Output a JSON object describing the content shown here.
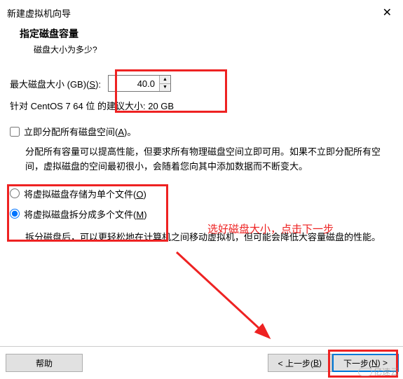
{
  "window": {
    "title": "新建虚拟机向导",
    "close": "✕"
  },
  "header": {
    "main": "指定磁盘容量",
    "sub": "磁盘大小为多少?"
  },
  "disk": {
    "size_label_pre": "最大磁盘大小 (GB)(",
    "size_label_key": "S",
    "size_label_post": "):",
    "size_value": "40.0",
    "rec_text": "针对 CentOS 7 64 位 的建议大小: 20 GB"
  },
  "allocate": {
    "label_pre": "立即分配所有磁盘空间(",
    "label_key": "A",
    "label_post": ")。",
    "desc": "分配所有容量可以提高性能，但要求所有物理磁盘空间立即可用。如果不立即分配所有空间，虚拟磁盘的空间最初很小，会随着您向其中添加数据而不断变大。"
  },
  "store": {
    "single_pre": "将虚拟磁盘存储为单个文件(",
    "single_key": "O",
    "single_post": ")",
    "split_pre": "将虚拟磁盘拆分成多个文件(",
    "split_key": "M",
    "split_post": ")",
    "split_desc": "拆分磁盘后，可以更轻松地在计算机之间移动虚拟机，但可能会降低大容量磁盘的性能。"
  },
  "annotation": {
    "text": "选好磁盘大小，点击下一步"
  },
  "footer": {
    "help": "帮助",
    "back_pre": "< 上一步(",
    "back_key": "B",
    "back_post": ")",
    "next_pre": "下一步(",
    "next_key": "N",
    "next_post": ") >"
  },
  "watermark": "亿速云"
}
